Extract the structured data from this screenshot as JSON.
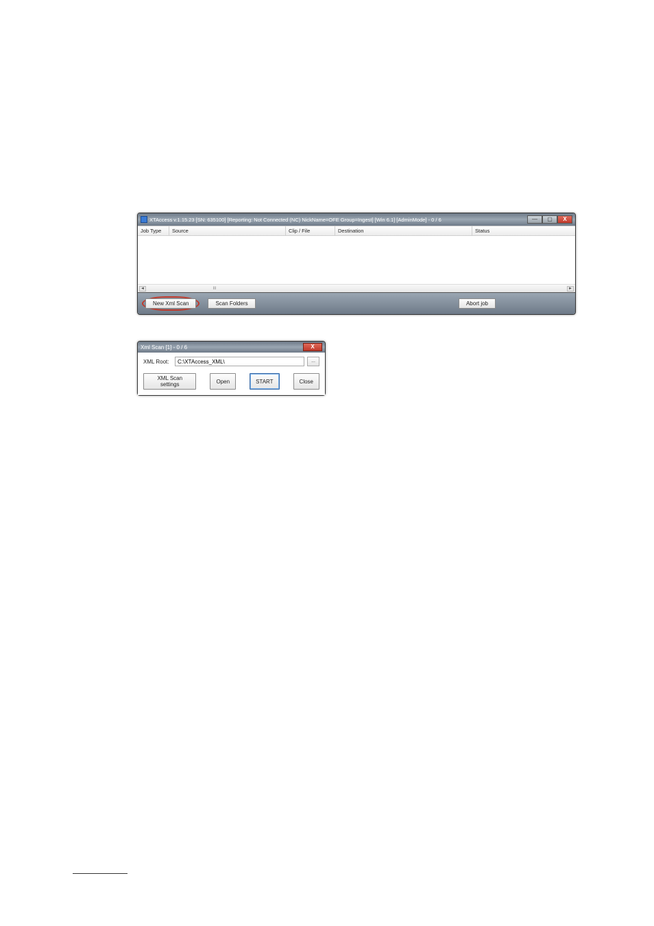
{
  "win1": {
    "title": "XTAccess v.1.15.23 [SN: 635100] [Reporting: Not Connected (NC) NickName=OFE Group=Ingest] [Win 6.1] [AdminMode] - 0 / 6",
    "columns": {
      "jobtype": "Job Type",
      "source": "Source",
      "clipfile": "Clip / File",
      "destination": "Destination",
      "status": "Status"
    },
    "buttons": {
      "new_xml_scan": "New Xml Scan",
      "scan_folders": "Scan Folders",
      "abort_job": "Abort job"
    },
    "scrollbar": {
      "marker": "III"
    }
  },
  "win2": {
    "title": "Xml Scan [1] - 0 / 6",
    "xml_root_label": "XML Root:",
    "xml_root_value": "C:\\XTAccess_XML\\",
    "browse_label": "...",
    "buttons": {
      "settings": "XML Scan settings",
      "open": "Open",
      "start": "START",
      "close": "Close"
    }
  },
  "glyphs": {
    "minimize": "—",
    "maximize": "▢",
    "close": "X",
    "left": "◄",
    "right": "►"
  }
}
